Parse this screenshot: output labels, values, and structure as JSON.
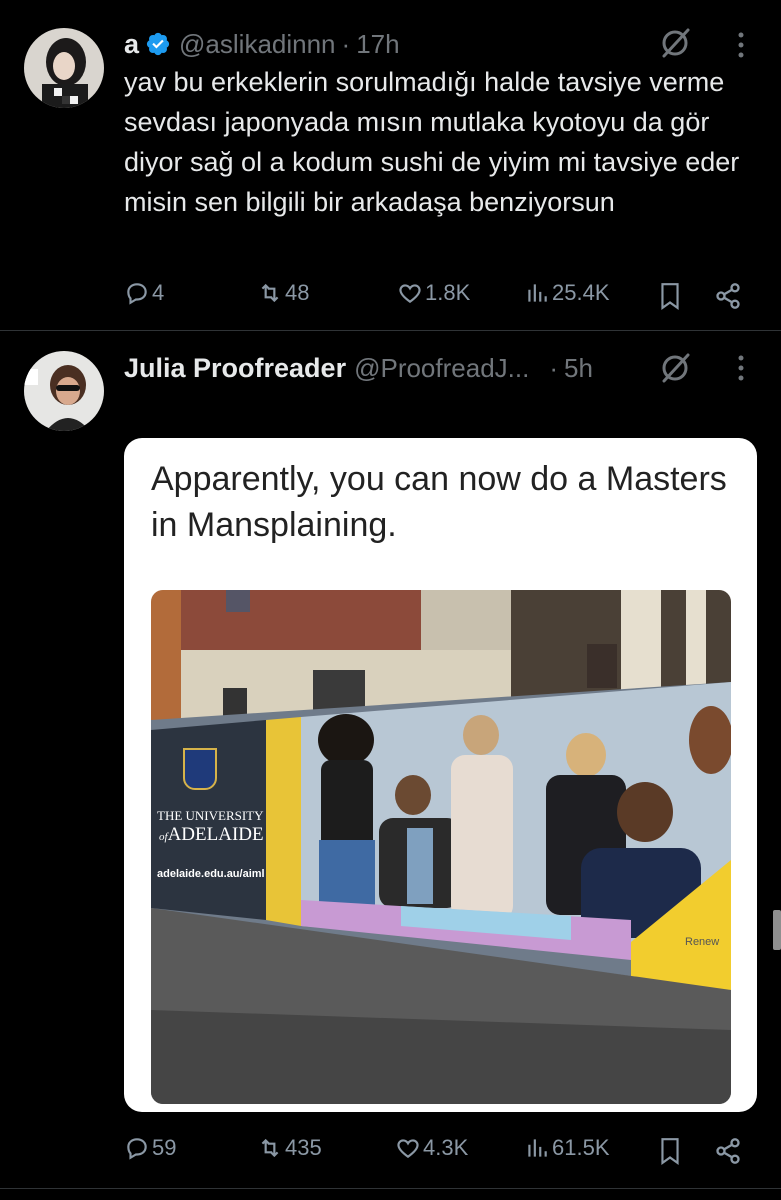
{
  "tweet1": {
    "name": "a",
    "handle": "@aslikadinnn",
    "dot": "·",
    "time": "17h",
    "text": "yav bu erkeklerin sorulmadığı halde tavsiye verme sevdası japonyada mısın mutlaka kyotoyu da gör diyor sağ ol a kodum sushi de yiyim mi tavsiye eder misin sen bilgili bir arkadaşa benziyorsun",
    "replies": "4",
    "reposts": "48",
    "likes": "1.8K",
    "views": "25.4K"
  },
  "tweet2": {
    "name": "Julia Proofreader",
    "handle": "@ProofreadJ...",
    "dot": "·",
    "time": "5h",
    "media_caption": "Apparently, you can now do a Masters in Mansplaining.",
    "billboard": {
      "university_line1": "THE UNIVERSITY",
      "university_line2": "ADELAIDE",
      "university_prefix": "of",
      "url": "adelaide.edu.au/aiml",
      "renew_text": "Renew"
    },
    "replies": "59",
    "reposts": "435",
    "likes": "4.3K",
    "views": "61.5K"
  },
  "colors": {
    "background": "#000000",
    "text": "#e7e9ea",
    "secondary": "#71767b",
    "verified": "#1d9bf0",
    "divider": "#2f3336"
  },
  "icons": [
    "verified-badge-icon",
    "grok-icon",
    "more-icon",
    "reply-icon",
    "repost-icon",
    "like-icon",
    "views-icon",
    "bookmark-icon",
    "share-icon"
  ]
}
